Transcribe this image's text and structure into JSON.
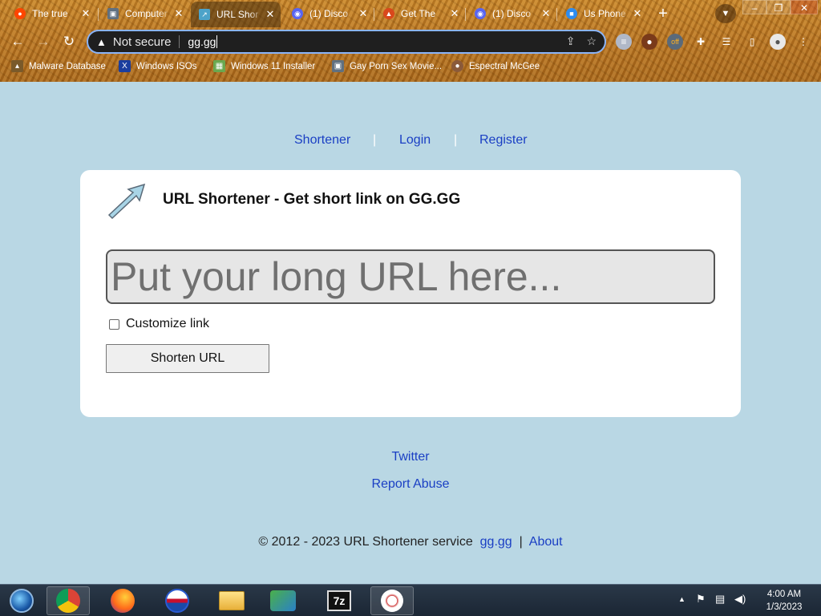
{
  "browser": {
    "tabs": [
      {
        "title": "The true",
        "favicon": "reddit-icon",
        "color": "#ff4500",
        "active": false
      },
      {
        "title": "Computer",
        "favicon": "computer-icon",
        "color": "#607080",
        "active": false
      },
      {
        "title": "URL Shor",
        "favicon": "gg-icon",
        "color": "#4da3c9",
        "active": true
      },
      {
        "title": "(1) Disco",
        "favicon": "discord-icon",
        "color": "#5865f2",
        "active": false
      },
      {
        "title": "Get The",
        "favicon": "fire-icon",
        "color": "#d9481c",
        "active": false
      },
      {
        "title": "(1) Disco",
        "favicon": "discord-icon",
        "color": "#5865f2",
        "active": false
      },
      {
        "title": "Us Phone",
        "favicon": "chat-icon",
        "color": "#2d8cf0",
        "active": false
      }
    ],
    "address": {
      "security_label": "Not secure",
      "url": "gg.gg"
    },
    "extension_badge": "off",
    "bookmarks": [
      {
        "label": "Malware Database",
        "icon": "malware-icon",
        "color": "#7a5a2a"
      },
      {
        "label": "Windows ISOs",
        "icon": "x-icon",
        "color": "#1b3e9e"
      },
      {
        "label": "Windows 11 Installer",
        "icon": "image-icon",
        "color": "#6aa84f"
      },
      {
        "label": "Gay Porn Sex Movie...",
        "icon": "computer-icon",
        "color": "#607080"
      },
      {
        "label": "Espectral McGee",
        "icon": "avatar-icon",
        "color": "#8a5a3a"
      }
    ]
  },
  "page": {
    "nav": {
      "shortener": "Shortener",
      "login": "Login",
      "register": "Register",
      "separator": "|"
    },
    "card": {
      "title": "URL Shortener - Get short link on GG.GG",
      "input_placeholder": "Put your long URL here...",
      "customize_label": "Customize link",
      "shorten_button": "Shorten URL"
    },
    "footer": {
      "twitter": "Twitter",
      "report_abuse": "Report Abuse",
      "copyright": "© 2012 - 2023 URL Shortener service",
      "site_link": "gg.gg",
      "separator": "|",
      "about": "About"
    }
  },
  "taskbar": {
    "time": "4:00 AM",
    "date": "1/3/2023",
    "tray_arrow": "▲",
    "apps": [
      "start-orb-icon",
      "chrome-icon",
      "firefox-icon",
      "obama-icon",
      "folder-icon",
      "network-icon",
      "7zip-icon",
      "snipping-tool-icon"
    ],
    "seven_zip_label": "7z"
  },
  "colors": {
    "page_bg": "#b9d7e4",
    "link": "#1a3fc4",
    "card_bg": "#ffffff"
  }
}
